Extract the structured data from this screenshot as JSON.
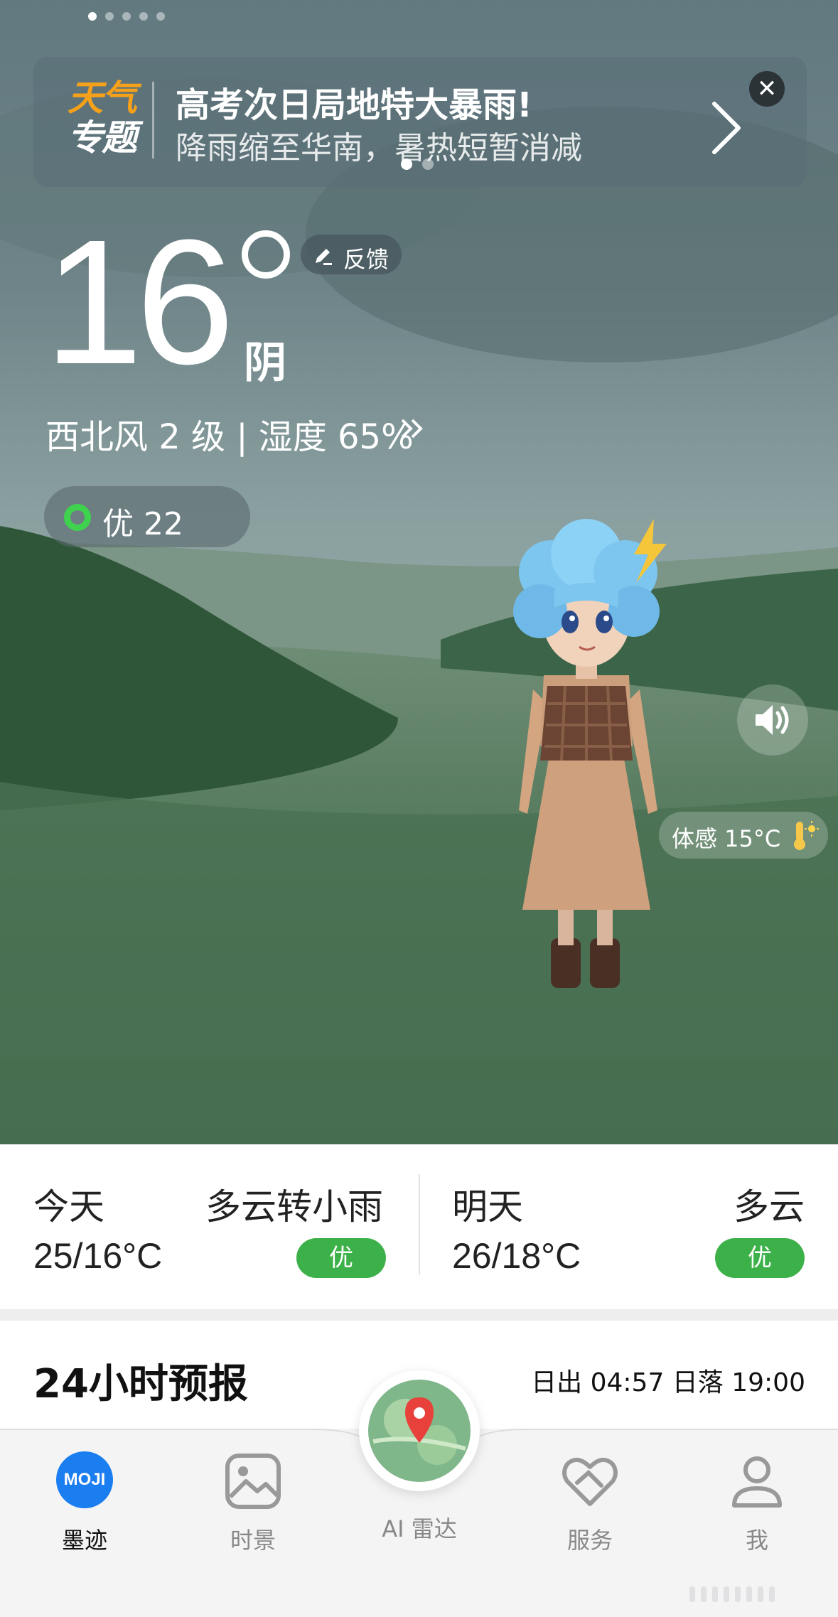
{
  "page_indicator": {
    "total": 5,
    "active_index": 0
  },
  "banner": {
    "logo_line1": "天气",
    "logo_line2": "专题",
    "title": "高考次日局地特大暴雨!",
    "subtitle": "降雨缩至华南，暑热短暂消减",
    "close_label": "✕",
    "dots": {
      "total": 2,
      "active_index": 0
    }
  },
  "current": {
    "temperature": "16",
    "condition": "阴",
    "feedback_label": "反馈",
    "wind_humidity": "西北风 2 级 | 湿度 65%",
    "aqi_label": "优 22",
    "feels_like": "体感 15°C"
  },
  "forecast": {
    "today": {
      "day": "今天",
      "desc": "多云转小雨",
      "temp": "25/16°C",
      "aqi": "优"
    },
    "tomorrow": {
      "day": "明天",
      "desc": "多云",
      "temp": "26/18°C",
      "aqi": "优"
    }
  },
  "hourly": {
    "title": "24小时预报",
    "sunrise_sunset": "日出 04:57  日落 19:00"
  },
  "tabs": [
    {
      "label": "墨迹",
      "icon": "moji-logo-icon",
      "icon_text": "MOJI",
      "active": true
    },
    {
      "label": "时景",
      "icon": "photo-icon",
      "active": false
    },
    {
      "label": "AI 雷达",
      "icon": "radar-map-icon",
      "active": false
    },
    {
      "label": "服务",
      "icon": "heart-handshake-icon",
      "active": false
    },
    {
      "label": "我",
      "icon": "person-icon",
      "active": false
    }
  ],
  "colors": {
    "aqi_green": "#3db149",
    "banner_orange": "#f6a11a",
    "moji_blue": "#1a7df0"
  }
}
